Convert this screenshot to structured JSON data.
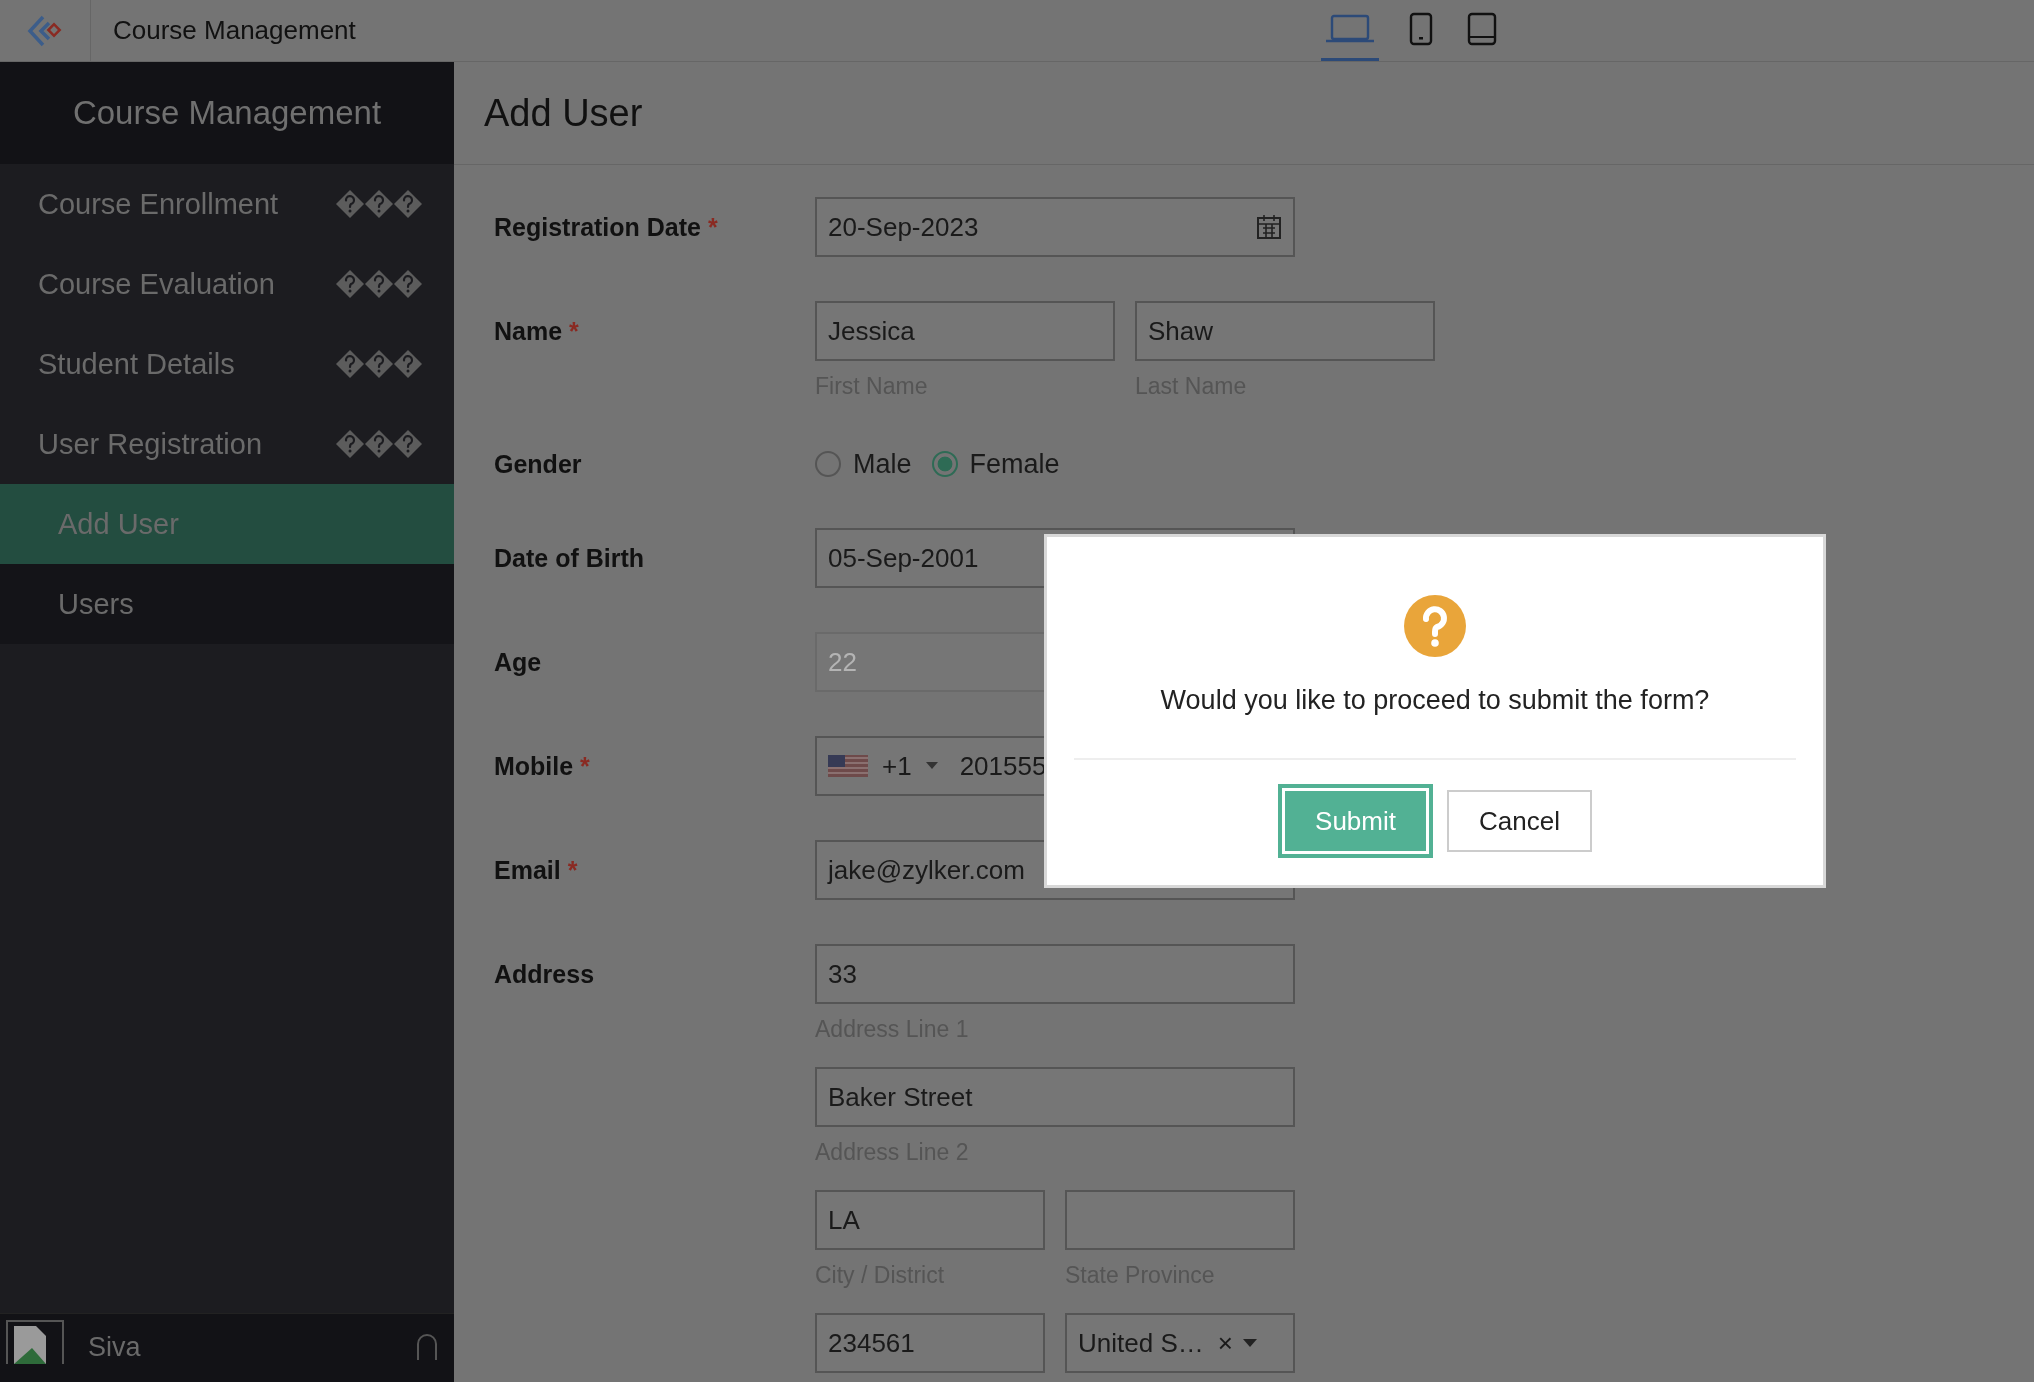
{
  "app_bar": {
    "title": "Course Management",
    "device_tabs": [
      {
        "kind": "laptop",
        "selected": true
      },
      {
        "kind": "phone",
        "selected": false
      },
      {
        "kind": "tablet",
        "selected": false
      }
    ]
  },
  "sidebar": {
    "title": "Course Management",
    "items": [
      {
        "label": "Course Enrollment"
      },
      {
        "label": "Course Evaluation"
      },
      {
        "label": "Student Details"
      },
      {
        "label": "User Registration",
        "children": [
          {
            "label": "Add User",
            "selected": true
          },
          {
            "label": "Users",
            "selected": false
          }
        ]
      }
    ],
    "user": {
      "name": "Siva"
    }
  },
  "page": {
    "title": "Add User"
  },
  "required_mark": "*",
  "form": [
    {
      "kind": "date",
      "label": "Registration Date",
      "required": true,
      "value": "20-Sep-2023"
    },
    {
      "kind": "name",
      "label": "Name",
      "required": true,
      "parts": [
        {
          "value": "Jessica",
          "caption": "First Name"
        },
        {
          "value": "Shaw",
          "caption": "Last Name"
        }
      ]
    },
    {
      "kind": "radio",
      "label": "Gender",
      "required": false,
      "options": [
        {
          "label": "Male",
          "selected": false
        },
        {
          "label": "Female",
          "selected": true
        }
      ]
    },
    {
      "kind": "text",
      "label": "Date of Birth",
      "required": false,
      "value": "05-Sep-2001",
      "disabled": false
    },
    {
      "kind": "text",
      "label": "Age",
      "required": false,
      "value": "22",
      "disabled": true
    },
    {
      "kind": "phone",
      "label": "Mobile",
      "required": true,
      "code": "+1",
      "value": "201555"
    },
    {
      "kind": "text",
      "label": "Email",
      "required": true,
      "value": "jake@zylker.com",
      "disabled": false
    },
    {
      "kind": "address",
      "label": "Address",
      "required": false,
      "rows": [
        [
          {
            "kind": "text",
            "value": "33",
            "caption": "Address Line 1"
          }
        ],
        [
          {
            "kind": "text",
            "value": "Baker Street",
            "caption": "Address Line 2"
          }
        ],
        [
          {
            "kind": "text",
            "value": "LA",
            "caption": "City / District"
          },
          {
            "kind": "text",
            "caption": "State Province"
          }
        ],
        [
          {
            "kind": "text",
            "value": "234561"
          },
          {
            "kind": "select",
            "value": "United S…",
            "clear": "×"
          }
        ]
      ]
    }
  ],
  "dialog": {
    "message": "Would you like to proceed to submit the form?",
    "buttons": [
      {
        "label": "Submit",
        "kind": "primary",
        "focused": true
      },
      {
        "label": "Cancel",
        "kind": "secondary",
        "focused": false
      }
    ]
  }
}
